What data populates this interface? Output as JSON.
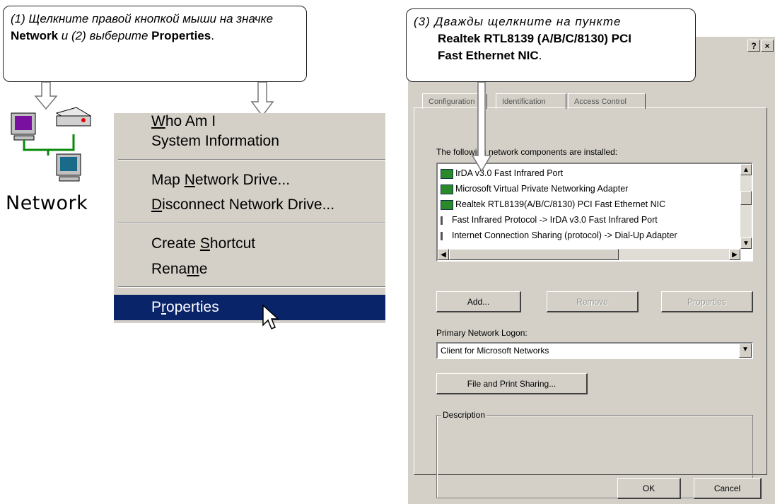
{
  "callout1": {
    "part1": "(1)  Щелкните правой кнопкой мыши на значке ",
    "bold1": "Network",
    "part2": " и (2) выберите ",
    "bold2": "Properties",
    "part3": "."
  },
  "callout3": {
    "part1": "(3)  Дважды щелкните на пункте",
    "bold1": "Realtek RTL8139 (A/B/C/8130) PCI",
    "bold2": "Fast Ethernet NIC",
    "part2": "."
  },
  "desktop_icon": {
    "label": "Network"
  },
  "context_menu": {
    "items": [
      {
        "pre": "",
        "u": "W",
        "post": "ho Am I"
      },
      {
        "pre": "System Information",
        "u": "",
        "post": ""
      },
      {
        "pre": "Map ",
        "u": "N",
        "post": "etwork Drive..."
      },
      {
        "pre": "",
        "u": "D",
        "post": "isconnect Network Drive..."
      },
      {
        "pre": "Create ",
        "u": "S",
        "post": "hortcut"
      },
      {
        "pre": "Rena",
        "u": "m",
        "post": "e"
      },
      {
        "pre": "P",
        "u": "r",
        "post": "operties"
      }
    ]
  },
  "dialog": {
    "title_help": "?",
    "title_close": "×",
    "tabs": [
      "Configuration",
      "Identification",
      "Access Control"
    ],
    "list_label": "The following network components are installed:",
    "components": [
      "IrDA v3.0 Fast Infrared Port",
      "Microsoft Virtual Private Networking Adapter",
      "Realtek RTL8139(A/B/C/8130) PCI Fast Ethernet NIC",
      "Fast Infrared Protocol -> IrDA v3.0 Fast Infrared Port",
      "Internet Connection Sharing (protocol) -> Dial-Up Adapter"
    ],
    "add_button": "Add...",
    "remove_button": "Remove",
    "properties_button": "Properties",
    "logon_label": "Primary Network Logon:",
    "logon_value": "Client for Microsoft Networks",
    "file_sharing_button": "File and Print Sharing...",
    "description_label": "Description",
    "ok_button": "OK",
    "cancel_button": "Cancel"
  }
}
